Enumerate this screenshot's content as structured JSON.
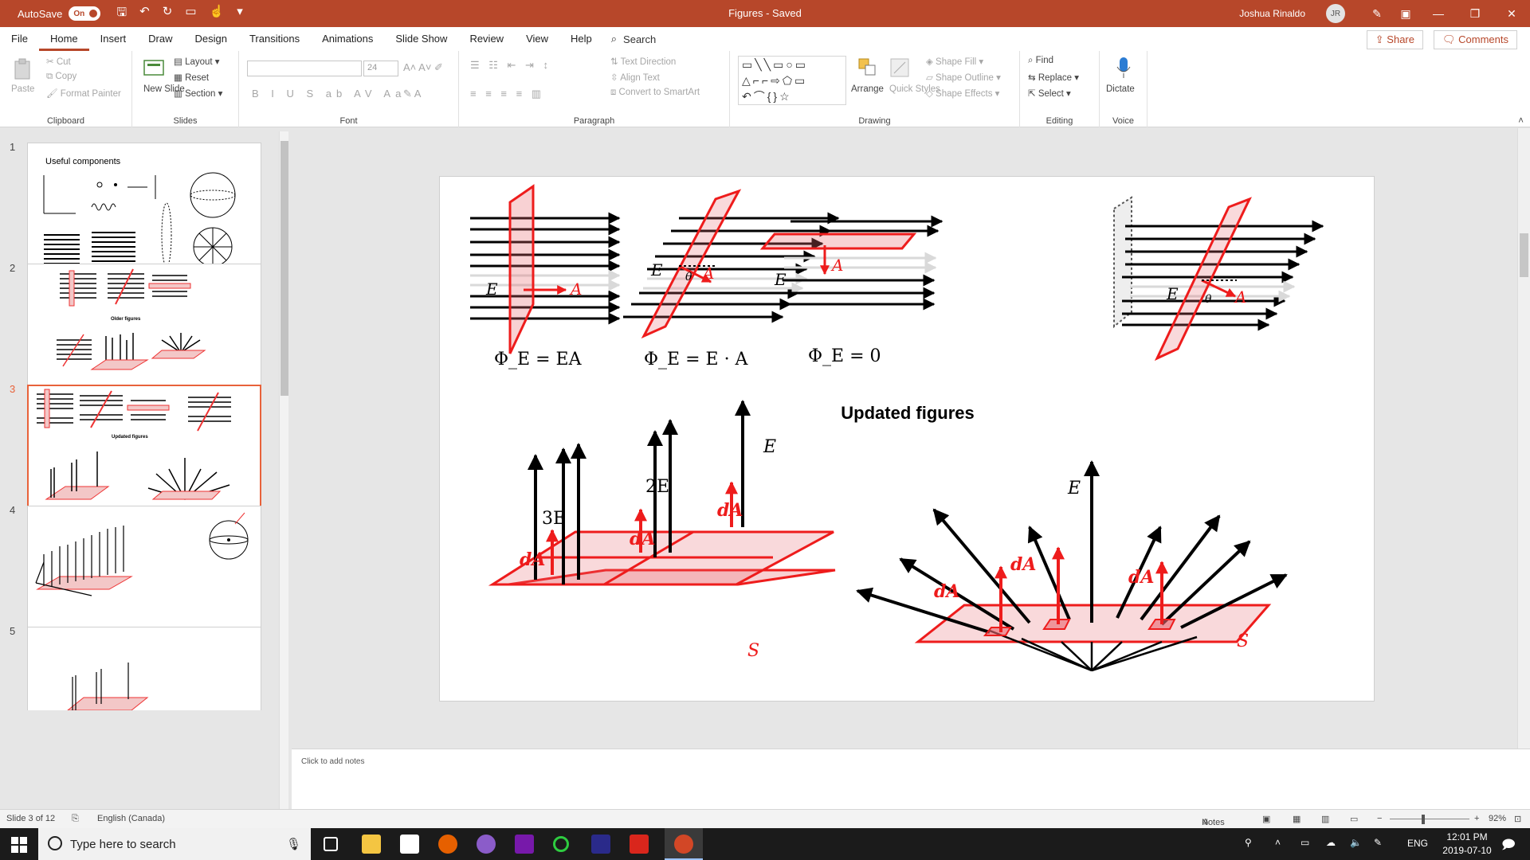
{
  "titlebar": {
    "autosave_label": "AutoSave",
    "autosave_state": "On",
    "doc_title": "Figures  -  Saved",
    "user_name": "Joshua Rinaldo",
    "user_initials": "JR"
  },
  "menu": {
    "tabs": [
      "File",
      "Home",
      "Insert",
      "Draw",
      "Design",
      "Transitions",
      "Animations",
      "Slide Show",
      "Review",
      "View",
      "Help"
    ],
    "active_tab": "Home",
    "search_label": "Search",
    "share_label": "Share",
    "comments_label": "Comments"
  },
  "ribbon": {
    "clipboard": {
      "paste": "Paste",
      "cut": "Cut",
      "copy": "Copy",
      "format_painter": "Format Painter",
      "label": "Clipboard"
    },
    "slides": {
      "new_slide": "New Slide",
      "layout": "Layout",
      "reset": "Reset",
      "section": "Section",
      "label": "Slides"
    },
    "font": {
      "size": "24",
      "label": "Font"
    },
    "paragraph": {
      "text_direction": "Text Direction",
      "align_text": "Align Text",
      "convert_smartart": "Convert to SmartArt",
      "label": "Paragraph"
    },
    "drawing": {
      "arrange": "Arrange",
      "quick_styles": "Quick Styles",
      "shape_fill": "Shape Fill",
      "shape_outline": "Shape Outline",
      "shape_effects": "Shape Effects",
      "label": "Drawing"
    },
    "editing": {
      "find": "Find",
      "replace": "Replace",
      "select": "Select",
      "label": "Editing"
    },
    "voice": {
      "dictate": "Dictate",
      "label": "Voice"
    }
  },
  "thumbnails": [
    {
      "num": "1",
      "title": "Useful components"
    },
    {
      "num": "2",
      "caption": "Older figures"
    },
    {
      "num": "3",
      "caption": "Updated figures"
    },
    {
      "num": "4"
    },
    {
      "num": "5"
    }
  ],
  "slide": {
    "heading": "Updated figures",
    "eq1": "Φ_E = EA",
    "eq2": "Φ_E = E · A",
    "eq3": "Φ_E = 0",
    "label_E": "E",
    "label_A": "A",
    "label_theta": "θ",
    "label_3E": "3E",
    "label_2E": "2E",
    "label_dA": "dA",
    "label_S": "S"
  },
  "notes_placeholder": "Click to add notes",
  "status": {
    "slide_info": "Slide 3 of 12",
    "language": "English (Canada)",
    "notes_label": "Notes",
    "zoom": "92%"
  },
  "taskbar": {
    "search_placeholder": "Type here to search",
    "lang": "ENG",
    "time": "12:01 PM",
    "date": "2019-07-10"
  }
}
